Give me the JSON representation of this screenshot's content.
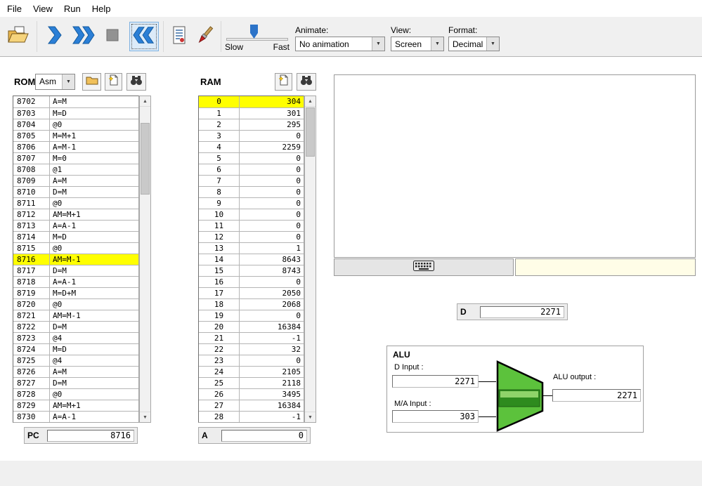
{
  "menu": {
    "items": [
      "File",
      "View",
      "Run",
      "Help"
    ]
  },
  "toolbar": {
    "slider_slow": "Slow",
    "slider_fast": "Fast",
    "animate_label": "Animate:",
    "animate_value": "No animation",
    "view_label": "View:",
    "view_value": "Screen",
    "format_label": "Format:",
    "format_value": "Decimal"
  },
  "icons": {
    "dropdown_arrow": "▼",
    "scroll_up": "▲",
    "scroll_down": "▼"
  },
  "rom": {
    "title": "ROM",
    "format_value": "Asm",
    "highlight": "8716",
    "rows": [
      [
        "8702",
        "A=M"
      ],
      [
        "8703",
        "M=D"
      ],
      [
        "8704",
        "@0"
      ],
      [
        "8705",
        "M=M+1"
      ],
      [
        "8706",
        "A=M-1"
      ],
      [
        "8707",
        "M=0"
      ],
      [
        "8708",
        "@1"
      ],
      [
        "8709",
        "A=M"
      ],
      [
        "8710",
        "D=M"
      ],
      [
        "8711",
        "@0"
      ],
      [
        "8712",
        "AM=M+1"
      ],
      [
        "8713",
        "A=A-1"
      ],
      [
        "8714",
        "M=D"
      ],
      [
        "8715",
        "@0"
      ],
      [
        "8716",
        "AM=M-1"
      ],
      [
        "8717",
        "D=M"
      ],
      [
        "8718",
        "A=A-1"
      ],
      [
        "8719",
        "M=D+M"
      ],
      [
        "8720",
        "@0"
      ],
      [
        "8721",
        "AM=M-1"
      ],
      [
        "8722",
        "D=M"
      ],
      [
        "8723",
        "@4"
      ],
      [
        "8724",
        "M=D"
      ],
      [
        "8725",
        "@4"
      ],
      [
        "8726",
        "A=M"
      ],
      [
        "8727",
        "D=M"
      ],
      [
        "8728",
        "@0"
      ],
      [
        "8729",
        "AM=M+1"
      ],
      [
        "8730",
        "A=A-1"
      ]
    ]
  },
  "ram": {
    "title": "RAM",
    "highlight": "0",
    "rows": [
      [
        "0",
        "304"
      ],
      [
        "1",
        "301"
      ],
      [
        "2",
        "295"
      ],
      [
        "3",
        "0"
      ],
      [
        "4",
        "2259"
      ],
      [
        "5",
        "0"
      ],
      [
        "6",
        "0"
      ],
      [
        "7",
        "0"
      ],
      [
        "8",
        "0"
      ],
      [
        "9",
        "0"
      ],
      [
        "10",
        "0"
      ],
      [
        "11",
        "0"
      ],
      [
        "12",
        "0"
      ],
      [
        "13",
        "1"
      ],
      [
        "14",
        "8643"
      ],
      [
        "15",
        "8743"
      ],
      [
        "16",
        "0"
      ],
      [
        "17",
        "2050"
      ],
      [
        "18",
        "2068"
      ],
      [
        "19",
        "0"
      ],
      [
        "20",
        "16384"
      ],
      [
        "21",
        "-1"
      ],
      [
        "22",
        "32"
      ],
      [
        "23",
        "0"
      ],
      [
        "24",
        "2105"
      ],
      [
        "25",
        "2118"
      ],
      [
        "26",
        "3495"
      ],
      [
        "27",
        "16384"
      ],
      [
        "28",
        "-1"
      ]
    ]
  },
  "pc": {
    "label": "PC",
    "value": "8716"
  },
  "a_reg": {
    "label": "A",
    "value": "0"
  },
  "d_reg": {
    "label": "D",
    "value": "2271"
  },
  "alu": {
    "title": "ALU",
    "d_input_label": "D Input :",
    "d_input_value": "2271",
    "ma_input_label": "M/A Input :",
    "ma_input_value": "303",
    "output_label": "ALU output :",
    "output_value": "2271"
  },
  "colors": {
    "highlight_yellow": "#ffff00",
    "alu_green": "#5cc23c",
    "arrow_blue": "#2b7fd6",
    "keyboard_field_yellow": "#fffde7"
  }
}
